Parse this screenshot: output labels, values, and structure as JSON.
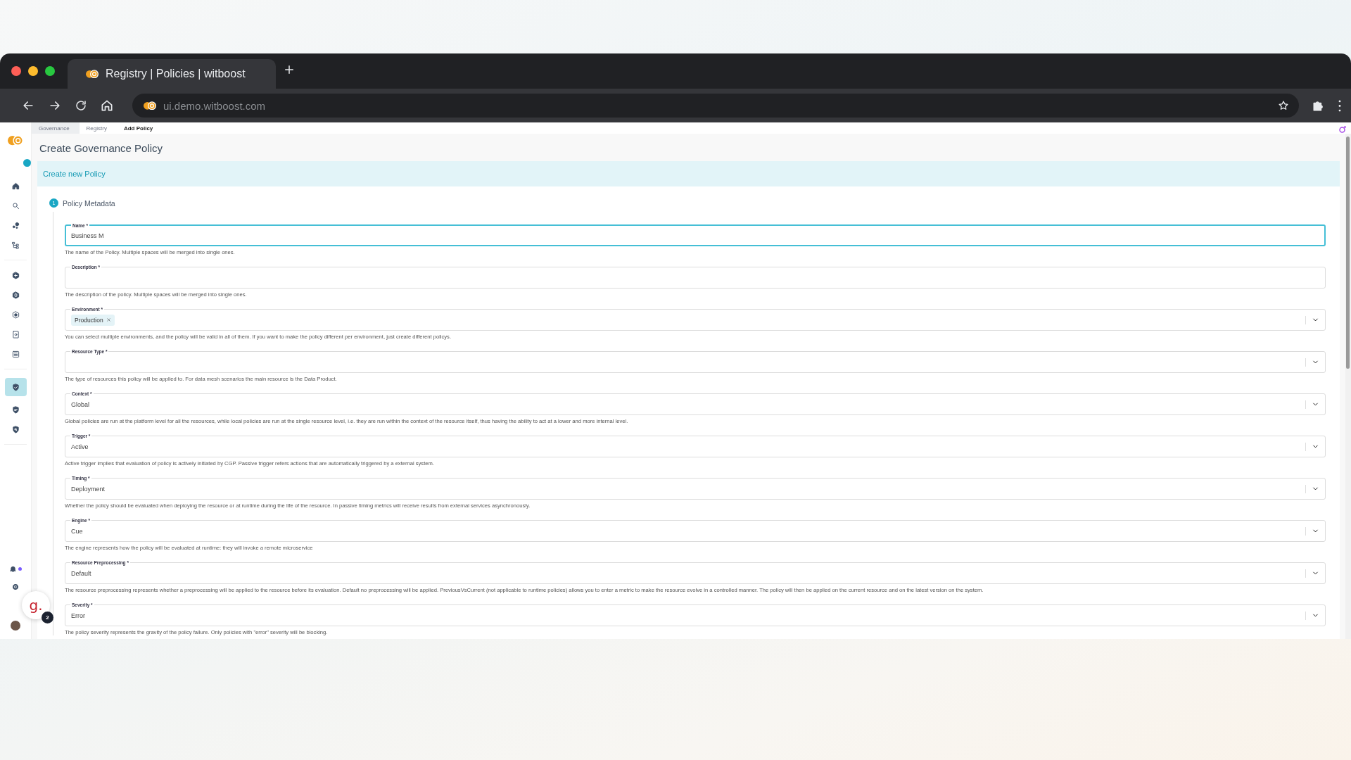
{
  "browser": {
    "tab_title": "Registry | Policies | witboost",
    "url": "ui.demo.witboost.com"
  },
  "sidebar": {
    "items": [
      {
        "selected": false
      },
      {
        "selected": false
      },
      {
        "selected": false
      },
      {
        "selected": false
      },
      {
        "selected": false
      },
      {
        "selected": false
      },
      {
        "selected": false
      },
      {
        "selected": false
      },
      {
        "selected": false
      },
      {
        "selected": true
      },
      {
        "selected": false
      },
      {
        "selected": false
      }
    ],
    "unread_notifications": true
  },
  "breadcrumbs": [
    {
      "label": "Governance",
      "selected": false
    },
    {
      "label": "Registry",
      "selected": false
    },
    {
      "label": "Add Policy",
      "selected": true
    }
  ],
  "page_title": "Create Governance Policy",
  "banner": "Create new Policy",
  "step": {
    "number": "1",
    "title": "Policy Metadata"
  },
  "fields": [
    {
      "kind": "text",
      "label": "Name *",
      "value": "Business M",
      "focused": true,
      "helper": "The name of the Policy. Multiple spaces will be merged into single ones."
    },
    {
      "kind": "text",
      "label": "Description *",
      "focused": false,
      "helper": "The description of the policy. Multiple spaces will be merged into single ones."
    },
    {
      "kind": "multiselect",
      "label": "Environment *",
      "chips": [
        "Production"
      ],
      "focused": false,
      "helper": "You can select multiple environments, and the policy will be valid in all of them. If you want to make the policy different per environment, just create different policys."
    },
    {
      "kind": "select",
      "label": "Resource Type *",
      "focused": false,
      "helper": "The type of resources this policy will be applied to. For data mesh scenarios the main resource is the Data Product."
    },
    {
      "kind": "select",
      "label": "Context *",
      "value": "Global",
      "focused": false,
      "helper": "Global policies are run at the platform level for all the resources, while local policies are run at the single resource level, i.e. they are run within the context of the resource itself, thus having the ability to act at a lower and more internal level."
    },
    {
      "kind": "select",
      "label": "Trigger *",
      "value": "Active",
      "focused": false,
      "helper": "Active trigger implies that evaluation of policy is actively initiated by CGP. Passive trigger refers actions that are automatically triggered by a external system."
    },
    {
      "kind": "select",
      "label": "Timing *",
      "value": "Deployment",
      "focused": false,
      "helper": "Whether the policy should be evaluated when deploying the resource or at runtime during the life of the resource. In passive timing metrics will receive results from external services asynchronously."
    },
    {
      "kind": "select",
      "label": "Engine *",
      "value": "Cue",
      "focused": false,
      "helper": "The engine represents how the policy will be evaluated at runtime: they will invoke a remote microservice"
    },
    {
      "kind": "select",
      "label": "Resource Preprocessing *",
      "value": "Default",
      "focused": false,
      "helper": "The resource preprocessing represents whether a preprocessing will be applied to the resource before its evaluation. Default no preprocessing will be applied. PreviousVsCurrent (not applicable to runtime policies) allows you to enter a metric to make the resource evolve in a controlled manner. The policy will then be applied on the current resource and on the latest version on the system."
    },
    {
      "kind": "select",
      "label": "Severity *",
      "value": "Error",
      "focused": false,
      "helper": "The policy severity represents the gravity of the policy failure. Only policies with \"error\" severity will be blocking."
    }
  ],
  "help_widget": {
    "logo": "g.",
    "badge": "2"
  }
}
